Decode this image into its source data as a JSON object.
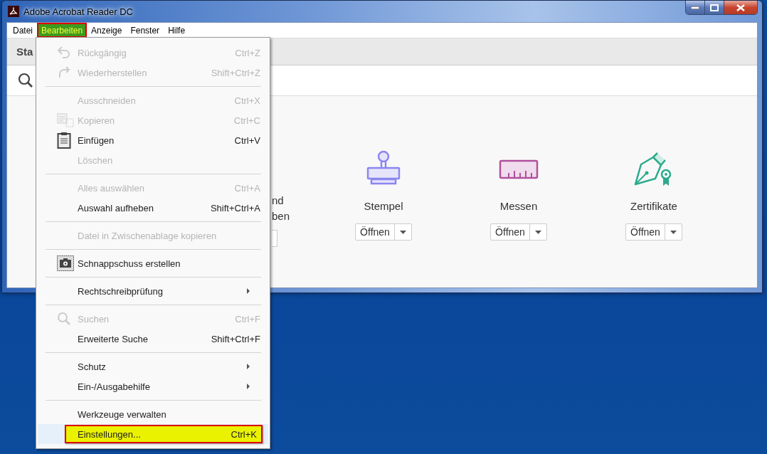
{
  "window": {
    "title": "Adobe Acrobat Reader DC"
  },
  "menu_bar": [
    {
      "label": "Datei",
      "selected": false
    },
    {
      "label": "Bearbeiten",
      "selected": true
    },
    {
      "label": "Anzeige",
      "selected": false
    },
    {
      "label": "Fenster",
      "selected": false
    },
    {
      "label": "Hilfe",
      "selected": false
    }
  ],
  "toolbar": {
    "tab": "Sta"
  },
  "tools": [
    {
      "kind": "partial",
      "label_lines": [
        "nd",
        "ben"
      ]
    },
    {
      "kind": "full",
      "label": "Stempel",
      "button": "Öffnen"
    },
    {
      "kind": "full",
      "label": "Messen",
      "button": "Öffnen"
    },
    {
      "kind": "full",
      "label": "Zertifikate",
      "button": "Öffnen"
    }
  ],
  "edit_menu": [
    {
      "kind": "item",
      "label": "Rückgängig",
      "shortcut": "Ctrl+Z",
      "disabled": true,
      "submenu": false,
      "selected": false
    },
    {
      "kind": "item",
      "label": "Wiederherstellen",
      "shortcut": "Shift+Ctrl+Z",
      "disabled": true,
      "submenu": false,
      "selected": false
    },
    {
      "kind": "separator"
    },
    {
      "kind": "item",
      "label": "Ausschneiden",
      "shortcut": "Ctrl+X",
      "disabled": true,
      "submenu": false,
      "selected": false
    },
    {
      "kind": "item",
      "label": "Kopieren",
      "shortcut": "Ctrl+C",
      "disabled": true,
      "submenu": false,
      "selected": false
    },
    {
      "kind": "item",
      "label": "Einfügen",
      "shortcut": "Ctrl+V",
      "disabled": false,
      "submenu": false,
      "selected": false
    },
    {
      "kind": "item",
      "label": "Löschen",
      "disabled": true,
      "submenu": false,
      "selected": false
    },
    {
      "kind": "separator"
    },
    {
      "kind": "item",
      "label": "Alles auswählen",
      "shortcut": "Ctrl+A",
      "disabled": true,
      "submenu": false,
      "selected": false
    },
    {
      "kind": "item",
      "label": "Auswahl aufheben",
      "shortcut": "Shift+Ctrl+A",
      "disabled": false,
      "submenu": false,
      "selected": false
    },
    {
      "kind": "separator"
    },
    {
      "kind": "item",
      "label": "Datei in Zwischenablage kopieren",
      "disabled": true,
      "submenu": false,
      "selected": false
    },
    {
      "kind": "separator"
    },
    {
      "kind": "item",
      "label": "Schnappschuss erstellen",
      "disabled": false,
      "submenu": false,
      "selected": false
    },
    {
      "kind": "separator"
    },
    {
      "kind": "item",
      "label": "Rechtschreibprüfung",
      "disabled": false,
      "submenu": true,
      "selected": false
    },
    {
      "kind": "separator"
    },
    {
      "kind": "item",
      "label": "Suchen",
      "shortcut": "Ctrl+F",
      "disabled": true,
      "submenu": false,
      "selected": false
    },
    {
      "kind": "item",
      "label": "Erweiterte Suche",
      "shortcut": "Shift+Ctrl+F",
      "disabled": false,
      "submenu": false,
      "selected": false
    },
    {
      "kind": "separator"
    },
    {
      "kind": "item",
      "label": "Schutz",
      "disabled": false,
      "submenu": true,
      "selected": false
    },
    {
      "kind": "item",
      "label": "Ein-/Ausgabehilfe",
      "disabled": false,
      "submenu": true,
      "selected": false
    },
    {
      "kind": "separator"
    },
    {
      "kind": "item",
      "label": "Werkzeuge verwalten",
      "disabled": false,
      "submenu": false,
      "selected": false
    },
    {
      "kind": "item",
      "label": "Einstellungen...",
      "shortcut": "Ctrl+K",
      "disabled": false,
      "submenu": false,
      "selected": true
    }
  ]
}
